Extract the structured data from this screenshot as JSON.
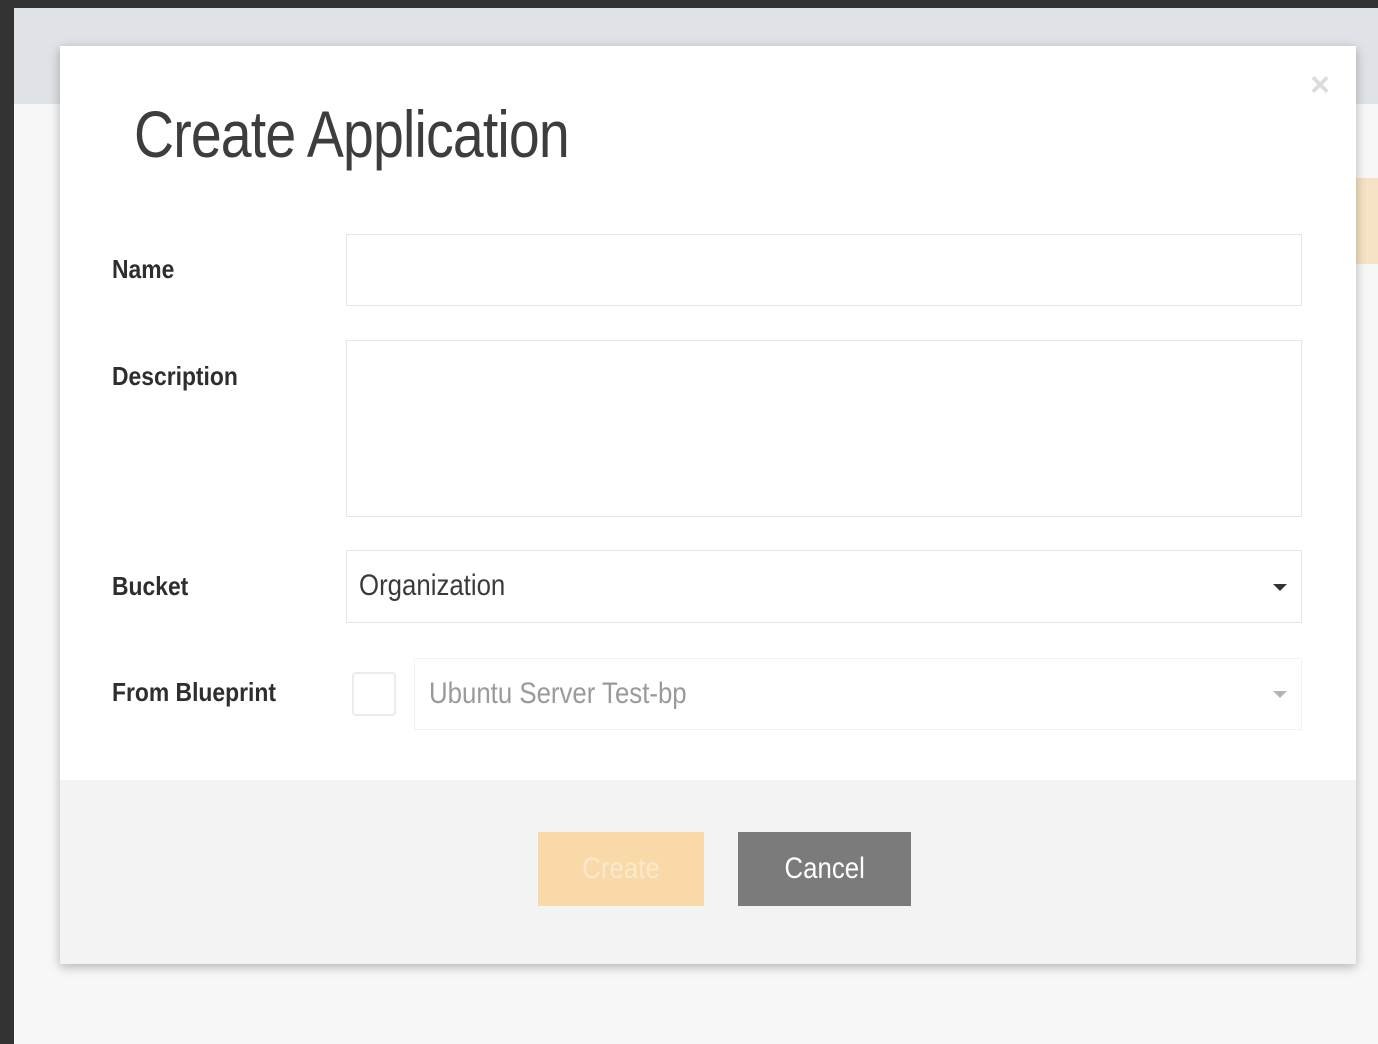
{
  "modal": {
    "title": "Create Application",
    "close_icon": "close-icon"
  },
  "form": {
    "name": {
      "label": "Name",
      "value": "",
      "placeholder": ""
    },
    "description": {
      "label": "Description",
      "value": "",
      "placeholder": ""
    },
    "bucket": {
      "label": "Bucket",
      "selected": "Organization"
    },
    "blueprint": {
      "label": "From Blueprint",
      "checked": false,
      "selected": "Ubuntu Server Test-bp"
    }
  },
  "footer": {
    "create_label": "Create",
    "cancel_label": "Cancel"
  },
  "colors": {
    "create_button": "#f9d9a8",
    "cancel_button": "#7b7b7b",
    "page_frame": "#333333"
  }
}
